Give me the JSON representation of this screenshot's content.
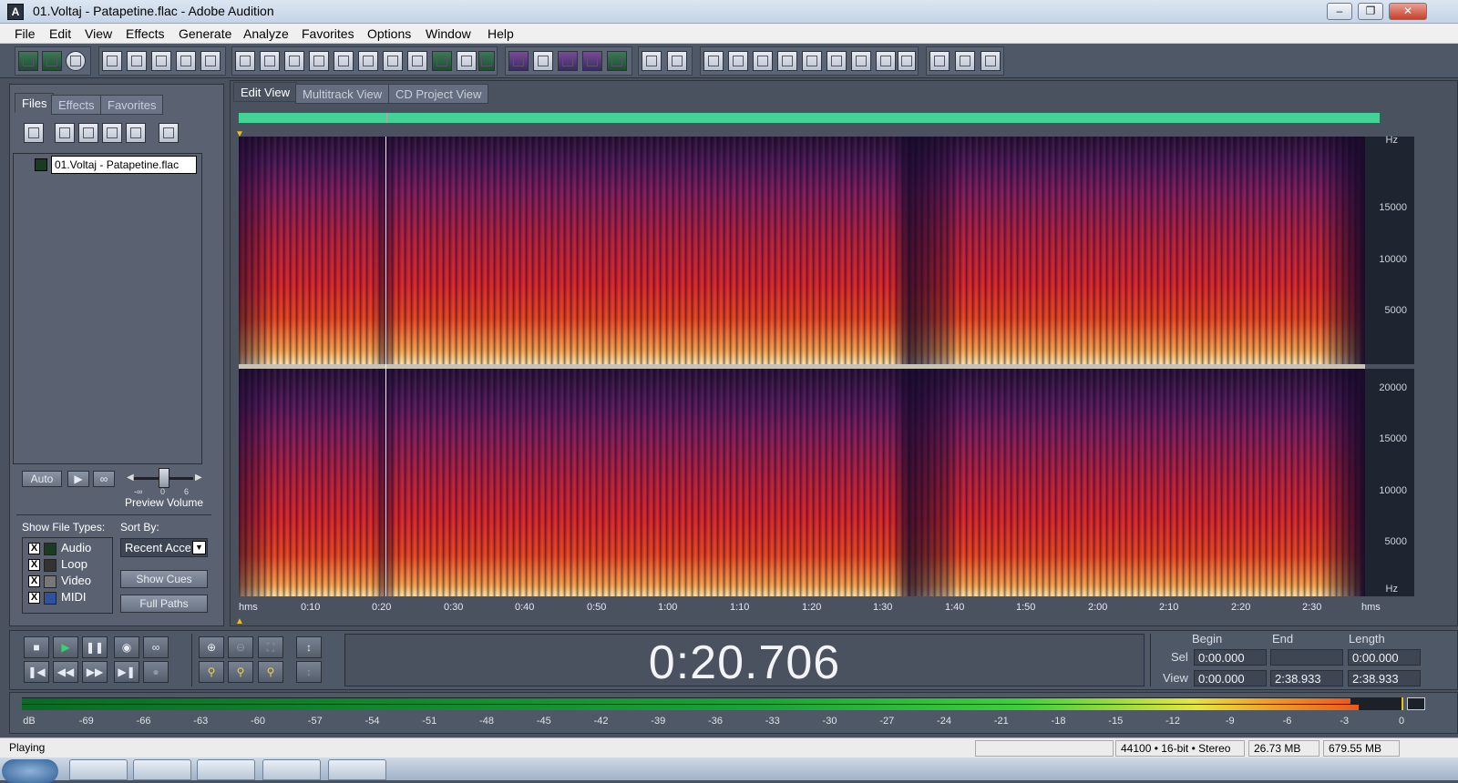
{
  "window": {
    "title": "01.Voltaj - Patapetine.flac - Adobe Audition",
    "app_icon": "audition-icon",
    "controls": [
      "minimize-icon",
      "maximize-icon",
      "close-icon"
    ]
  },
  "menu": [
    "File",
    "Edit",
    "View",
    "Effects",
    "Generate",
    "Analyze",
    "Favorites",
    "Options",
    "Window",
    "Help"
  ],
  "left_panel": {
    "tabs": [
      "Files",
      "Effects",
      "Favorites"
    ],
    "active_tab": "Files",
    "file_name": "01.Voltaj - Patapetine.flac",
    "auto_button": "Auto",
    "preview_volume_label": "Preview Volume",
    "volume_marks": [
      "-∞",
      "0",
      "6"
    ],
    "show_file_types_label": "Show File Types:",
    "sort_by_label": "Sort By:",
    "sort_by_value": "Recent Acce",
    "file_types": [
      {
        "label": "Audio",
        "checked": "X",
        "icon": "audio-icon"
      },
      {
        "label": "Loop",
        "checked": "X",
        "icon": "loop-icon"
      },
      {
        "label": "Video",
        "checked": "X",
        "icon": "video-icon"
      },
      {
        "label": "MIDI",
        "checked": "X",
        "icon": "midi-icon"
      }
    ],
    "show_cues_button": "Show Cues",
    "full_paths_button": "Full Paths"
  },
  "view_tabs": [
    "Edit View",
    "Multitrack View",
    "CD Project View"
  ],
  "active_view": "Edit View",
  "spectral": {
    "freq_unit": "Hz",
    "top_channel_ticks": [
      "15000",
      "10000",
      "5000"
    ],
    "bottom_channel_ticks": [
      "20000",
      "15000",
      "10000",
      "5000"
    ],
    "time_unit": "hms",
    "time_ticks": [
      "0:10",
      "0:20",
      "0:30",
      "0:40",
      "0:50",
      "1:00",
      "1:10",
      "1:20",
      "1:30",
      "1:40",
      "1:50",
      "2:00",
      "2:10",
      "2:20",
      "2:30"
    ],
    "playhead_time": "0:20.706"
  },
  "time_display": "0:20.706",
  "selection": {
    "headers": {
      "begin": "Begin",
      "end": "End",
      "length": "Length"
    },
    "sel_label": "Sel",
    "view_label": "View",
    "sel": {
      "begin": "0:00.000",
      "end": "",
      "length": "0:00.000"
    },
    "view": {
      "begin": "0:00.000",
      "end": "2:38.933",
      "length": "2:38.933"
    }
  },
  "level_meter": {
    "ticks": [
      "dB",
      "-69",
      "-66",
      "-63",
      "-60",
      "-57",
      "-54",
      "-51",
      "-48",
      "-45",
      "-42",
      "-39",
      "-36",
      "-33",
      "-30",
      "-27",
      "-24",
      "-21",
      "-18",
      "-15",
      "-12",
      "-9",
      "-6",
      "-3",
      "0"
    ],
    "left_level_fraction": 0.963,
    "right_level_fraction": 0.969
  },
  "status": {
    "state": "Playing",
    "format": "44100 • 16-bit • Stereo",
    "file_size": "26.73 MB",
    "free_space": "679.55 MB"
  }
}
